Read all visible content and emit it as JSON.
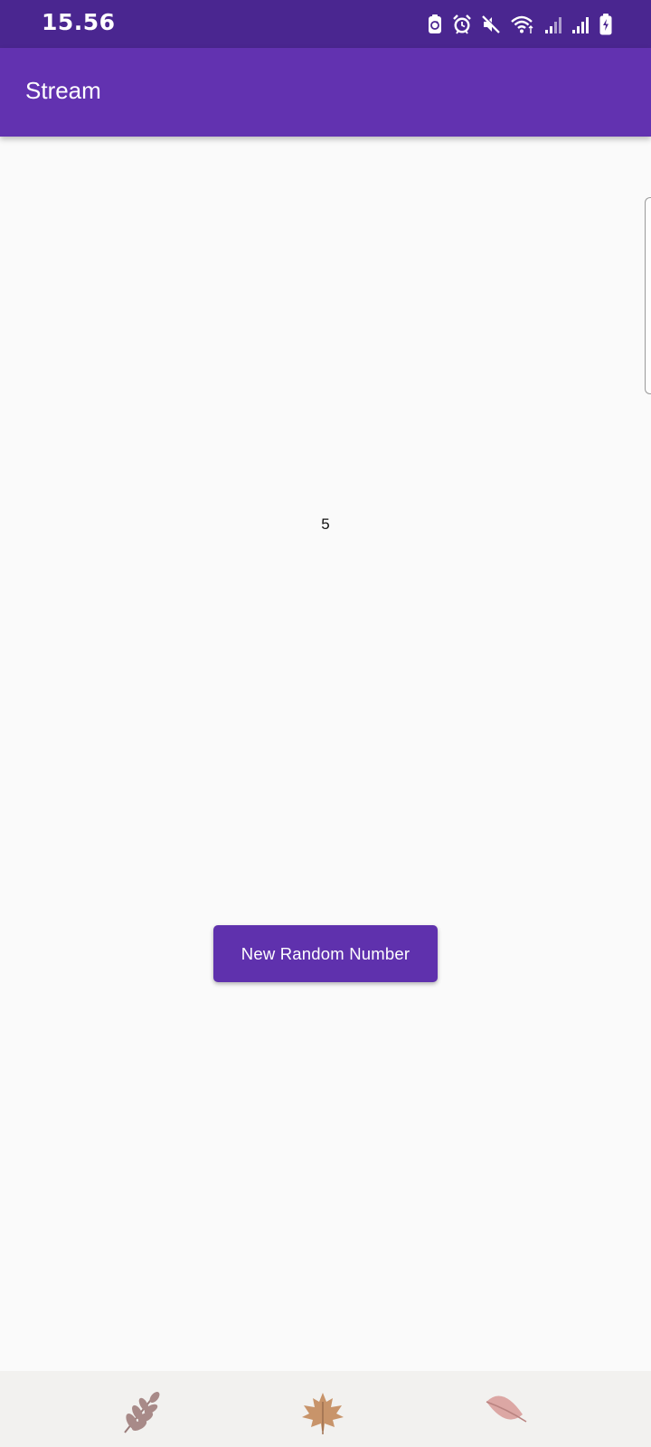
{
  "status_bar": {
    "time": "15.56",
    "icons": [
      "sync-icon",
      "alarm-icon",
      "mute-icon",
      "wifi-icon",
      "signal-icon",
      "signal-icon",
      "battery-charging-icon"
    ]
  },
  "app_bar": {
    "title": "Stream"
  },
  "main": {
    "number_value": "5",
    "button_label": "New Random Number"
  },
  "bottom_strip": {
    "icons": [
      "fern-leaf-icon",
      "maple-leaf-icon",
      "leaf-icon"
    ]
  },
  "colors": {
    "status_bar": "#4a2690",
    "app_bar": "#6232b0",
    "button": "#5f31ad",
    "background": "#fafafa"
  }
}
